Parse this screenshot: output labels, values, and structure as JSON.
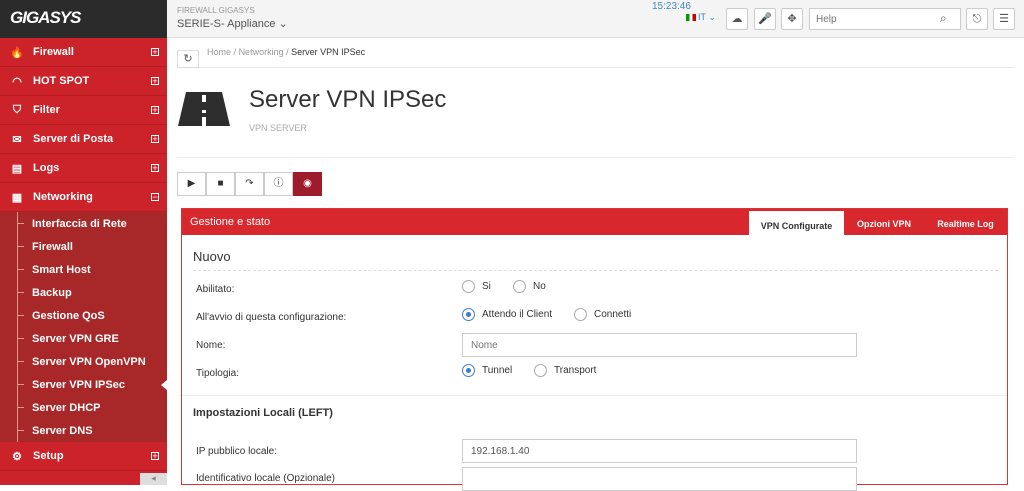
{
  "header": {
    "logo": "GIGASYS",
    "product_top": "FIREWALL GIGASYS",
    "product_select": "SERIE-S- Appliance",
    "clock": "15:23:46",
    "lang": "IT",
    "search_placeholder": "Help"
  },
  "sidebar": {
    "items": [
      {
        "label": "Firewall",
        "icon": "fire-icon"
      },
      {
        "label": "HOT SPOT",
        "icon": "wifi-icon"
      },
      {
        "label": "Filter",
        "icon": "shield-icon"
      },
      {
        "label": "Server di Posta",
        "icon": "mail-icon"
      },
      {
        "label": "Logs",
        "icon": "logs-icon"
      },
      {
        "label": "Networking",
        "icon": "network-icon"
      }
    ],
    "subitems": [
      "Interfaccia di Rete",
      "Firewall",
      "Smart Host",
      "Backup",
      "Gestione QoS",
      "Server VPN GRE",
      "Server VPN OpenVPN",
      "Server VPN IPSec",
      "Server DHCP",
      "Server DNS"
    ],
    "active_subitem": "Server VPN IPSec",
    "bottom_item": {
      "label": "Setup",
      "icon": "gear-icon"
    }
  },
  "breadcrumb": {
    "home": "Home",
    "sep": "/",
    "parent": "Networking",
    "current": "Server VPN IPSec"
  },
  "page": {
    "title": "Server VPN IPSec",
    "subtitle": "VPN SERVER"
  },
  "panel": {
    "title": "Gestione e stato",
    "tabs": [
      "VPN Configurate",
      "Opzioni VPN",
      "Realtime Log"
    ],
    "active_tab": "VPN Configurate",
    "section_new": "Nuovo",
    "fields": {
      "abilitato_label": "Abilitato:",
      "abilitato_opts": [
        "Si",
        "No"
      ],
      "avvio_label": "All'avvio di questa configurazione:",
      "avvio_opts": [
        "Attendo il Client",
        "Connetti"
      ],
      "nome_label": "Nome:",
      "nome_placeholder": "Nome",
      "tipologia_label": "Tipologia:",
      "tipologia_opts": [
        "Tunnel",
        "Transport"
      ]
    },
    "local_section": "Impostazioni Locali (LEFT)",
    "ip_label": "IP pubblico locale:",
    "ip_value": "192.168.1.40",
    "id_label": "Identificativo locale (Opzionale)"
  },
  "colors": {
    "sidebar_red": "#cc2229",
    "submenu_red": "#a82729",
    "accent_blue": "#3a7bd5",
    "record_button": "#9e1b2e"
  }
}
